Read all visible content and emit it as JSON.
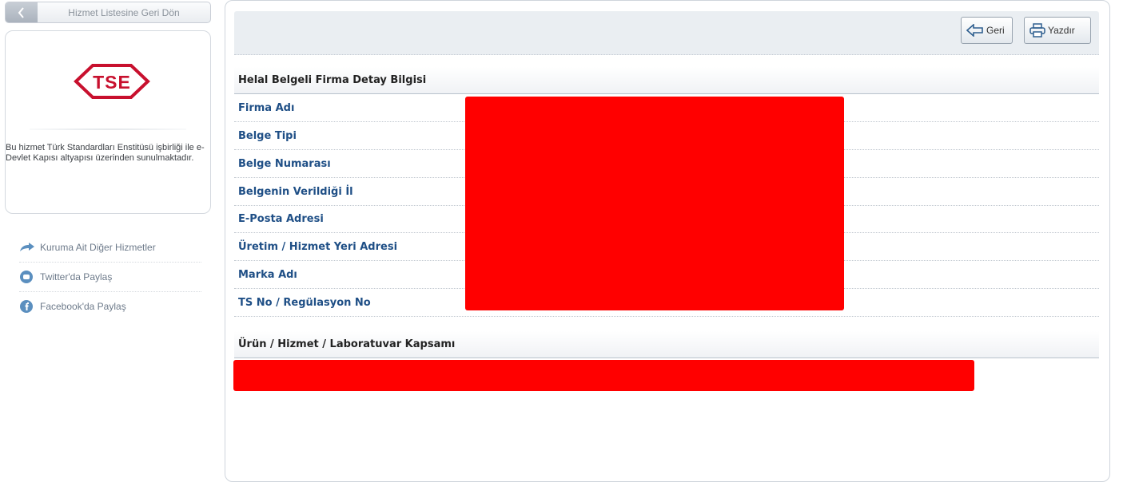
{
  "sidebar": {
    "back_label": "Hizmet Listesine Geri Dön",
    "logo_text": "TSE",
    "info_text": "Bu hizmet Türk Standardları Enstitüsü işbirliği ile e-Devlet Kapısı altyapısı üzerinden sunulmaktadır.",
    "links": [
      {
        "label": "Kuruma Ait Diğer Hizmetler",
        "icon": "arrow-share-icon"
      },
      {
        "label": "Twitter'da Paylaş",
        "icon": "twitter-icon"
      },
      {
        "label": "Facebook'da Paylaş",
        "icon": "facebook-icon"
      }
    ]
  },
  "toolbar": {
    "back_label": "Geri",
    "print_label": "Yazdır"
  },
  "detail": {
    "title": "Helal Belgeli Firma Detay Bilgisi",
    "rows": [
      "Firma Adı",
      "Belge Tipi",
      "Belge Numarası",
      "Belgenin Verildiği İl",
      "E-Posta Adresi",
      "Üretim / Hizmet Yeri Adresi",
      "Marka Adı",
      "TS No / Regülasyon No"
    ]
  },
  "scope": {
    "title": "Ürün / Hizmet / Laboratuvar Kapsamı"
  },
  "colors": {
    "label_blue": "#1f4f86",
    "redaction": "#ff0000",
    "logo_red": "#c8102e"
  }
}
